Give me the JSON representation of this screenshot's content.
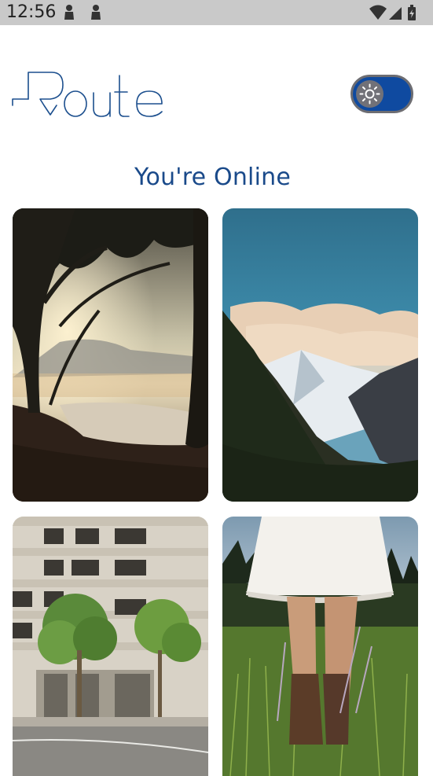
{
  "status_bar": {
    "time": "12:56",
    "icons": [
      "notification-icon",
      "notification-icon",
      "wifi-icon",
      "signal-icon",
      "battery-icon"
    ]
  },
  "header": {
    "logo_text": "Route",
    "theme_toggle": {
      "icon": "sun-icon",
      "state": "on",
      "color": "#0f4aa0"
    }
  },
  "main": {
    "status_text": "You're Online",
    "status_color": "#1a4a8a",
    "gallery": [
      {
        "subject": "forest lake sunrise"
      },
      {
        "subject": "snowy mountain valley"
      },
      {
        "subject": "building with trees"
      },
      {
        "subject": "person in white dress with boots in grass"
      }
    ]
  }
}
